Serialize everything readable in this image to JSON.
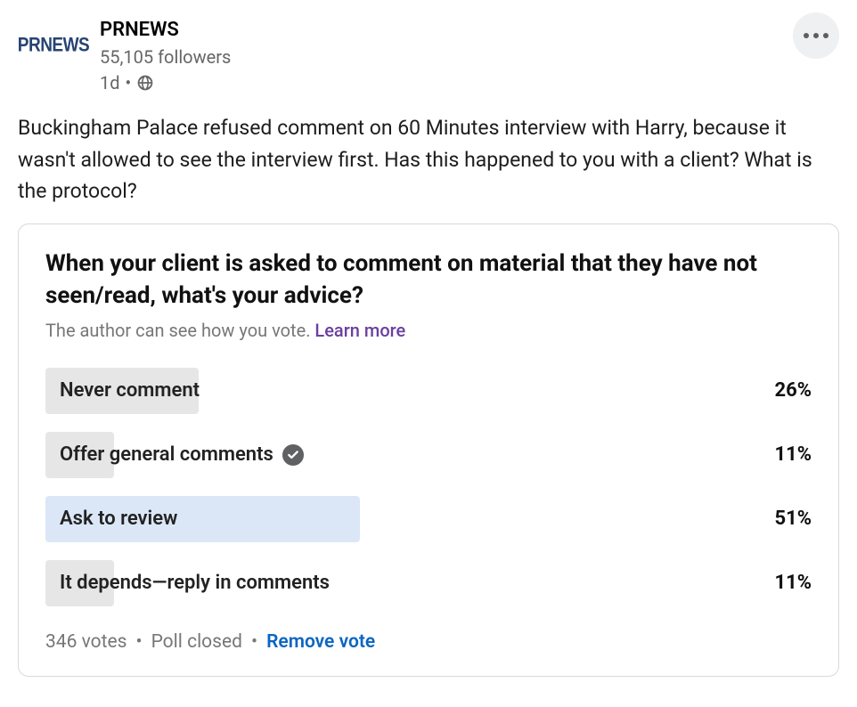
{
  "author": {
    "name": "PRNEWS",
    "logo_text": "PRNEWS",
    "followers": "55,105 followers",
    "time": "1d"
  },
  "post_text": "Buckingham Palace refused comment on 60 Minutes interview with Harry, because it wasn't allowed to see the interview first. Has this happened to you with a client? What is the protocol?",
  "poll": {
    "question": "When your client is asked to comment on material that they have not seen/read, what's your advice?",
    "note_text": "The author can see how you vote. ",
    "note_link": "Learn more",
    "options": [
      {
        "label": "Never comment",
        "pct": "26%",
        "width": "20%",
        "selected": false,
        "highlight": false
      },
      {
        "label": "Offer general comments",
        "pct": "11%",
        "width": "9%",
        "selected": true,
        "highlight": false
      },
      {
        "label": "Ask to review",
        "pct": "51%",
        "width": "41%",
        "selected": false,
        "highlight": true
      },
      {
        "label": "It depends—reply in comments",
        "pct": "11%",
        "width": "9%",
        "selected": false,
        "highlight": false
      }
    ],
    "footer": {
      "votes": "346 votes",
      "status": "Poll closed",
      "action": "Remove vote"
    }
  }
}
